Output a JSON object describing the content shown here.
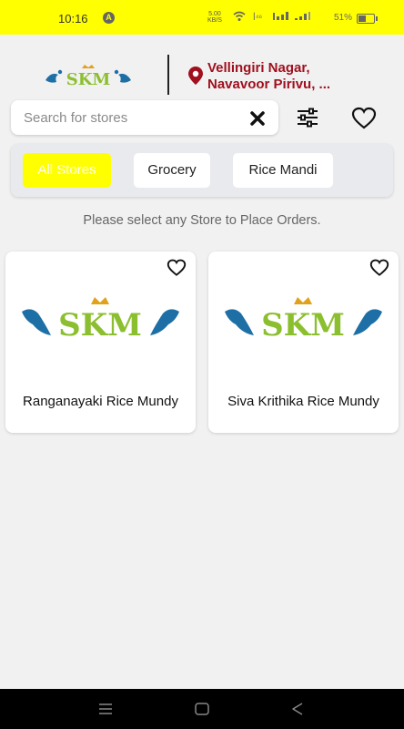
{
  "status_bar": {
    "time": "10:16",
    "speed_value": "5.00",
    "speed_unit": "KB/S",
    "battery": "51%"
  },
  "header": {
    "logo_text": "SKM",
    "location_line1": "Vellingiri Nagar,",
    "location_line2": "Navavoor Pirivu, ..."
  },
  "search": {
    "placeholder": "Search for stores"
  },
  "filters": {
    "chips": [
      "All Stores",
      "Grocery",
      "Rice Mandi"
    ],
    "selected": "All Stores"
  },
  "hint": "Please select any Store to Place Orders.",
  "stores": [
    {
      "name": "Ranganayaki Rice Mundy",
      "logo_text": "SKM"
    },
    {
      "name": "Siva Krithika Rice Mundy",
      "logo_text": "SKM"
    }
  ],
  "colors": {
    "accent": "#ffff00",
    "location": "#a0101e",
    "logo_green": "#8cbf2f",
    "logo_gold": "#e0a21b",
    "peacock_blue": "#1e6fa6"
  }
}
